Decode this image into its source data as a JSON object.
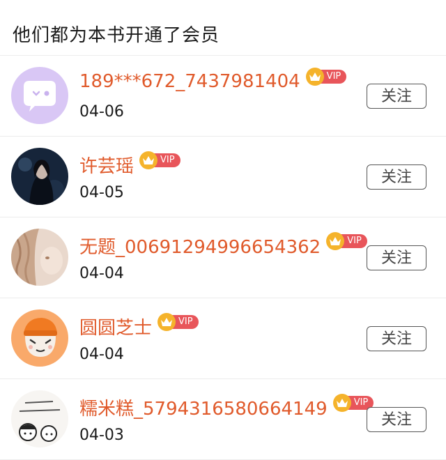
{
  "header": {
    "title": "他们都为本书开通了会员"
  },
  "vip_label": "VIP",
  "colors": {
    "username": "#e05a2b",
    "vip_badge": "#e8555a",
    "crown": "#f5b32b"
  },
  "members": [
    {
      "name": "189***672_7437981404",
      "date": "04-06",
      "follow_label": "关注",
      "avatar": "chat-bubble-icon"
    },
    {
      "name": "许芸瑶",
      "date": "04-05",
      "follow_label": "关注",
      "avatar": "user-photo"
    },
    {
      "name": "无题_00691294996654362",
      "date": "04-04",
      "follow_label": "关注",
      "avatar": "user-photo"
    },
    {
      "name": "圆圆芝士",
      "date": "04-04",
      "follow_label": "关注",
      "avatar": "cartoon-avatar"
    },
    {
      "name": "糯米糕_5794316580664149",
      "date": "04-03",
      "follow_label": "关注",
      "avatar": "doodle-avatar"
    }
  ]
}
